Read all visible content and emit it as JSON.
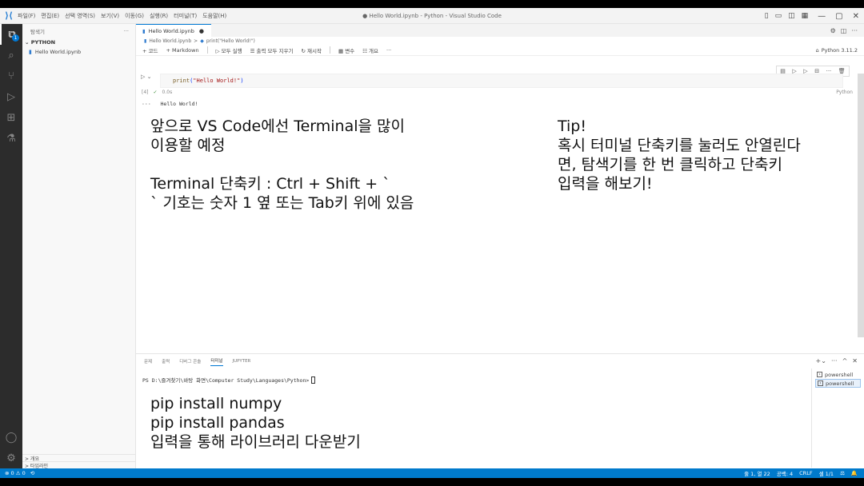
{
  "titlebar": {
    "logo": "VS Code logo",
    "menu": [
      "파일(F)",
      "편집(E)",
      "선택 영역(S)",
      "보기(V)",
      "이동(G)",
      "실행(R)",
      "터미널(T)",
      "도움말(H)"
    ],
    "window_title": "● Hello World.ipynb - Python - Visual Studio Code",
    "controls": {
      "minimize": "—",
      "maximize": "▢",
      "close": "✕"
    }
  },
  "activity_bar": {
    "items": [
      {
        "icon": "files-icon",
        "glyph": "⧉",
        "badge": "1"
      },
      {
        "icon": "search-icon",
        "glyph": "⌕"
      },
      {
        "icon": "source-control-icon",
        "glyph": "⑂"
      },
      {
        "icon": "run-debug-icon",
        "glyph": "▷"
      },
      {
        "icon": "extensions-icon",
        "glyph": "⊞"
      },
      {
        "icon": "testing-icon",
        "glyph": "⚗"
      }
    ],
    "bottom": [
      {
        "icon": "account-icon",
        "glyph": "◯"
      },
      {
        "icon": "manage-gear-icon",
        "glyph": "⚙"
      }
    ]
  },
  "sidebar": {
    "title": "탐색기",
    "more": "···",
    "folder": "PYTHON",
    "files": [
      "Hello World.ipynb"
    ],
    "outline": [
      "> 개요",
      "> 타임라인"
    ]
  },
  "editor": {
    "tab_label": "Hello World.ipynb",
    "tab_dirty": "●",
    "breadcrumb": {
      "file": "Hello World.ipynb",
      "sep": ">",
      "cell": "print(\"Hello World!\")"
    },
    "toolbar": {
      "add_code": "+ 코드",
      "add_markdown": "+ Markdown",
      "run_all": "▷ 모두 실행",
      "clear_outputs": "☰ 출력 모두 지우기",
      "restart": "↻ 재시작",
      "variables": "▦ 변수",
      "outline": "☷ 개요",
      "more": "···",
      "kernel": "Python 3.11.2"
    },
    "cell": {
      "run_glyph": "▷",
      "exec_count": "[4]",
      "check": "✓",
      "duration": "0.0s",
      "code_func": "print",
      "code_open": "(",
      "code_str": "\"Hello World!\"",
      "code_close": ")",
      "language": "Python",
      "output_prefix": "···",
      "output": "Hello World!"
    }
  },
  "annotations": {
    "main_lines": [
      "앞으로 VS Code에선 Terminal을 많이",
      "이용할 예정",
      "",
      "Terminal 단축키 : Ctrl + Shift + `",
      "` 기호는 숫자 1 옆 또는 Tab키 위에 있음"
    ],
    "tip_lines": [
      "Tip!",
      "혹시 터미널 단축키를 눌러도 안열린다",
      "면, 탐색기를 한 번 클릭하고 단축키",
      "입력을 해보기!"
    ],
    "terminal_lines": [
      "pip install numpy",
      "pip install pandas",
      "입력을 통해 라이브러리 다운받기"
    ]
  },
  "panel": {
    "tabs": [
      "문제",
      "출력",
      "디버그 콘솔",
      "터미널",
      "JUPYTER"
    ],
    "active_tab": "터미널",
    "actions": [
      "+⌄",
      "···",
      "^",
      "✕"
    ],
    "prompt": "PS D:\\즐겨찾기\\바탕 화면\\Computer Study\\Languages\\Python>",
    "terminals": [
      "powershell",
      "powershell"
    ]
  },
  "statusbar": {
    "left": "⊗ 0 ⚠ 0",
    "remote": "⟲",
    "right": [
      "줄 1, 열 22",
      "공백: 4",
      "CRLF",
      "셀 1/1",
      "⚖",
      "🔔"
    ]
  },
  "colors": {
    "accent": "#007acc",
    "activity_bg": "#2c2c2c",
    "string": "#a31515"
  }
}
